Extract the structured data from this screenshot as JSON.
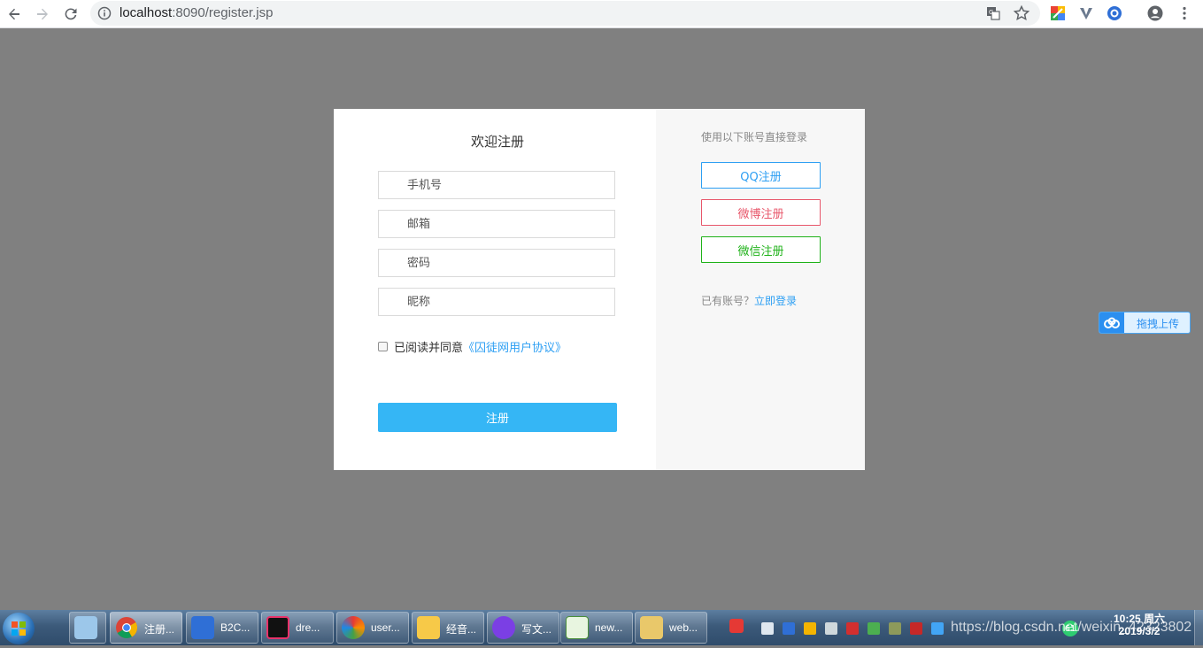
{
  "browser": {
    "url_host": "localhost",
    "url_port_path": ":8090/register.jsp"
  },
  "register": {
    "title": "欢迎注册",
    "phone_placeholder": "手机号",
    "email_placeholder": "邮箱",
    "password_placeholder": "密码",
    "nickname_placeholder": "昵称",
    "agree_text": "已阅读并同意",
    "agreement_link": "《囚徒网用户协议》",
    "submit_label": "注册"
  },
  "social": {
    "title": "使用以下账号直接登录",
    "qq_label": "QQ注册",
    "weibo_label": "微博注册",
    "wechat_label": "微信注册",
    "has_account_text": "已有账号？",
    "login_link": "立即登录"
  },
  "upload_widget": {
    "label": "拖拽上传"
  },
  "taskbar": {
    "items": [
      {
        "label": "注册..."
      },
      {
        "label": "B2C..."
      },
      {
        "label": "dre..."
      },
      {
        "label": "user..."
      },
      {
        "label": "经音..."
      },
      {
        "label": "写文..."
      },
      {
        "label": "new..."
      },
      {
        "label": "web..."
      }
    ],
    "clock_time": "10:25 周六",
    "clock_date": "2019/3/2",
    "badge": "61",
    "watermark": "https://blog.csdn.net/weixin_42323802"
  },
  "colors": {
    "accent": "#35b6f5",
    "link": "#2d9ff3",
    "weibo": "#e8566a",
    "wechat": "#1fb219",
    "backdrop": "#808080"
  }
}
